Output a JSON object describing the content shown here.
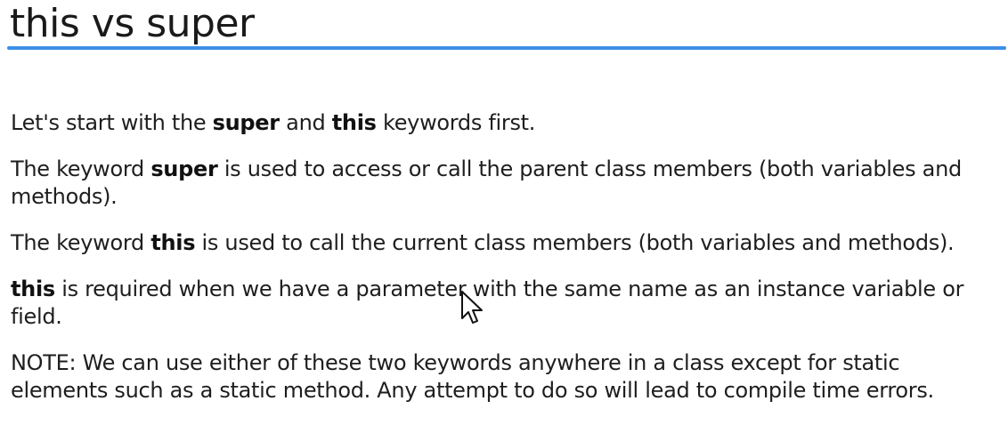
{
  "slide": {
    "title": "this vs super",
    "accent_color": "#3d8fe6"
  },
  "paragraphs": {
    "p1": {
      "a": "Let's start with the ",
      "b": "super",
      "c": " and ",
      "d": "this",
      "e": " keywords first."
    },
    "p2": {
      "a": "The keyword ",
      "b": "super",
      "c": " is used to access or call the parent class members (both variables and methods)."
    },
    "p3": {
      "a": "The keyword ",
      "b": "this",
      "c": " is used to call the current class members (both variables and methods)."
    },
    "p4": {
      "a": "this",
      "b": " is required when we have a parameter with the same name as an instance variable or field."
    },
    "p5": {
      "a": "NOTE: We can use either of these two keywords anywhere in a class except for static elements such as a static method. Any attempt to do so will lead to compile time errors."
    }
  },
  "cursor": {
    "icon": "mouse-pointer-icon"
  }
}
